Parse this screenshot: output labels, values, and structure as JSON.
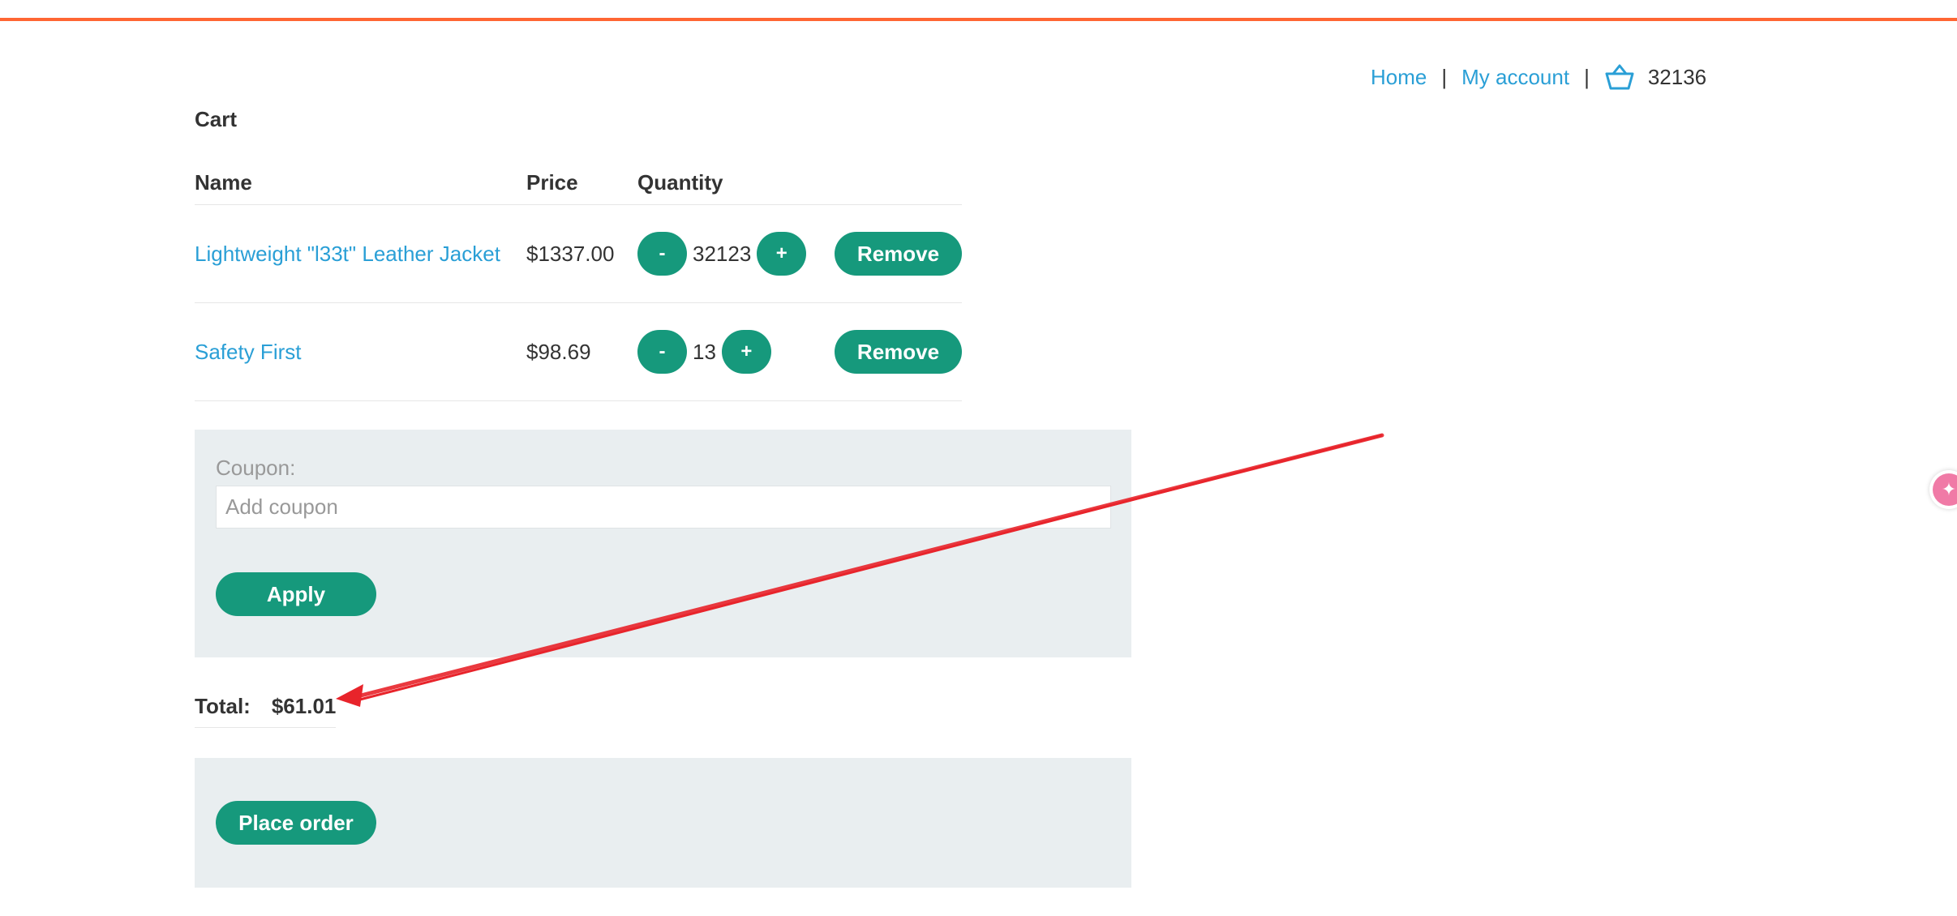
{
  "nav": {
    "home": "Home",
    "separator": "|",
    "my_account": "My account",
    "cart_count": "32136"
  },
  "cart": {
    "title": "Cart",
    "columns": {
      "name": "Name",
      "price": "Price",
      "quantity": "Quantity"
    },
    "items": [
      {
        "name": "Lightweight \"l33t\" Leather Jacket",
        "price": "$1337.00",
        "quantity": "32123",
        "minus": "-",
        "plus": "+",
        "remove": "Remove"
      },
      {
        "name": "Safety First",
        "price": "$98.69",
        "quantity": "13",
        "minus": "-",
        "plus": "+",
        "remove": "Remove"
      }
    ]
  },
  "coupon": {
    "label": "Coupon:",
    "placeholder": "Add coupon",
    "value": "",
    "apply": "Apply"
  },
  "total": {
    "label": "Total:",
    "value": "$61.01"
  },
  "order": {
    "place_order": "Place order"
  },
  "colors": {
    "accent": "#ff6633",
    "link": "#2a9fd6",
    "button": "#16997c",
    "panel": "#e9eef0",
    "annotation_arrow": "#e8242b"
  }
}
